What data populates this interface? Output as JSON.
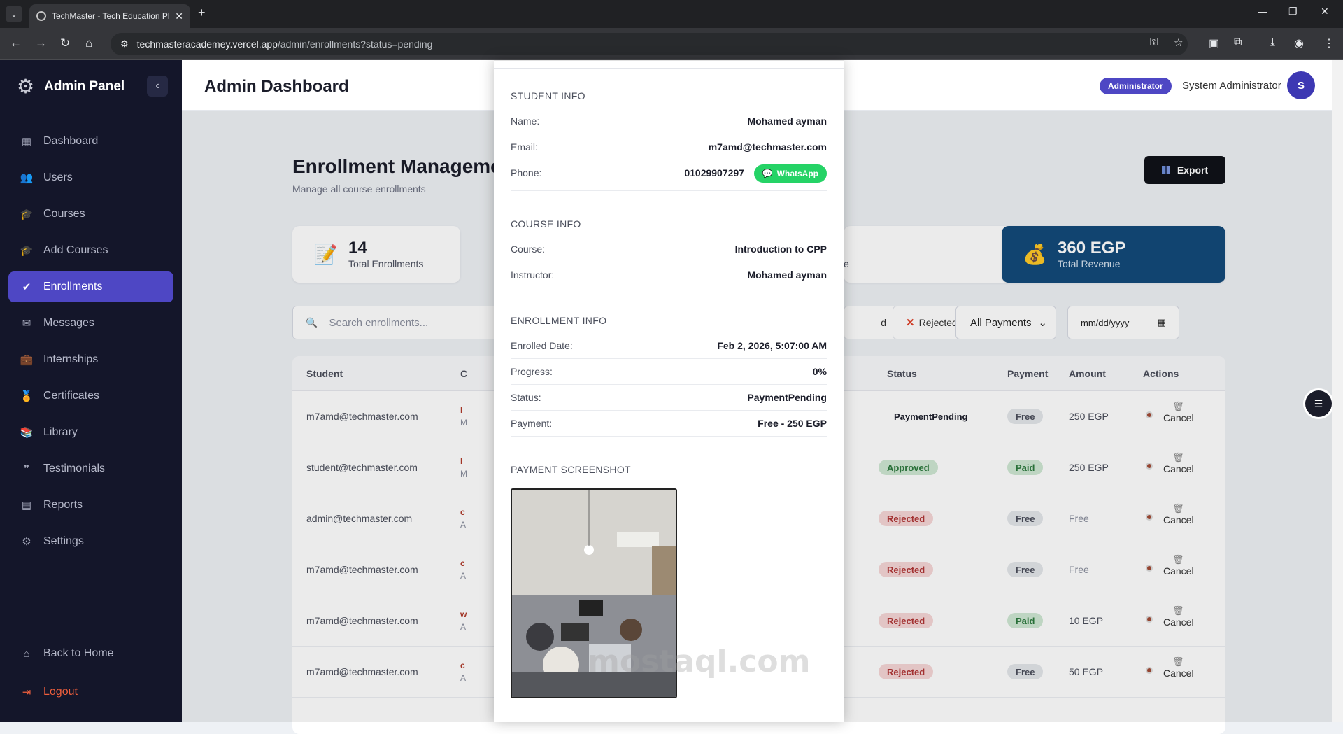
{
  "browser": {
    "tab_title": "TechMaster - Tech Education Pl",
    "url_host": "techmasteracademey.vercel.app",
    "url_path": "/admin/enrollments?status=pending"
  },
  "sidebar": {
    "title": "Admin Panel",
    "items": [
      {
        "label": "Dashboard",
        "icon": "dashboard-icon"
      },
      {
        "label": "Users",
        "icon": "users-icon"
      },
      {
        "label": "Courses",
        "icon": "courses-icon"
      },
      {
        "label": "Add Courses",
        "icon": "add-courses-icon"
      },
      {
        "label": "Enrollments",
        "icon": "enrollments-icon"
      },
      {
        "label": "Messages",
        "icon": "messages-icon"
      },
      {
        "label": "Internships",
        "icon": "internships-icon"
      },
      {
        "label": "Certificates",
        "icon": "certificates-icon"
      },
      {
        "label": "Library",
        "icon": "library-icon"
      },
      {
        "label": "Testimonials",
        "icon": "testimonials-icon"
      },
      {
        "label": "Reports",
        "icon": "reports-icon"
      },
      {
        "label": "Settings",
        "icon": "settings-icon"
      }
    ],
    "back_home": "Back to Home",
    "logout": "Logout"
  },
  "header": {
    "title": "Admin Dashboard",
    "role_badge": "Administrator",
    "user_name": "System Administrator",
    "avatar_letter": "S"
  },
  "page": {
    "title": "Enrollment Manageme",
    "subtitle": "Manage all course enrollments",
    "export_label": "Export"
  },
  "stats": {
    "total": {
      "value": "14",
      "label": "Total Enrollments"
    },
    "revenue": {
      "value": "360 EGP",
      "label": "Total Revenue"
    },
    "partial_label": "e"
  },
  "filters": {
    "search_placeholder": "Search enrollments...",
    "approved_stub": "d",
    "rejected_label": "Rejected",
    "payments_select": "All Payments",
    "date_placeholder": "mm/dd/yyyy"
  },
  "table": {
    "headers": {
      "student": "Student",
      "course_stub": "C",
      "status": "Status",
      "payment": "Payment",
      "amount": "Amount",
      "actions": "Actions"
    },
    "rows": [
      {
        "email": "m7amd@techmaster.com",
        "c1": "I",
        "c2": "M",
        "status": "PaymentPending",
        "payment": "Free",
        "amount": "250 EGP"
      },
      {
        "email": "student@techmaster.com",
        "c1": "I",
        "c2": "M",
        "status": "Approved",
        "payment": "Paid",
        "amount": "250 EGP"
      },
      {
        "email": "admin@techmaster.com",
        "c1": "c",
        "c2": "A",
        "status": "Rejected",
        "payment": "Free",
        "amount": "Free"
      },
      {
        "email": "m7amd@techmaster.com",
        "c1": "c",
        "c2": "A",
        "status": "Rejected",
        "payment": "Free",
        "amount": "Free"
      },
      {
        "email": "m7amd@techmaster.com",
        "c1": "w",
        "c2": "A",
        "status": "Rejected",
        "payment": "Paid",
        "amount": "10 EGP"
      },
      {
        "email": "m7amd@techmaster.com",
        "c1": "c",
        "c2": "A",
        "status": "Rejected",
        "payment": "Free",
        "amount": "50 EGP"
      }
    ],
    "cancel_label": "Cancel"
  },
  "modal": {
    "student_section": "STUDENT INFO",
    "name_k": "Name:",
    "name_v": "Mohamed ayman",
    "email_k": "Email:",
    "email_v": "m7amd@techmaster.com",
    "phone_k": "Phone:",
    "phone_v": "01029907297",
    "whatsapp": "WhatsApp",
    "course_section": "COURSE INFO",
    "course_k": "Course:",
    "course_v": "Introduction to CPP",
    "instructor_k": "Instructor:",
    "instructor_v": "Mohamed ayman",
    "enroll_section": "ENROLLMENT INFO",
    "date_k": "Enrolled Date:",
    "date_v": "Feb 2, 2026, 5:07:00 AM",
    "progress_k": "Progress:",
    "progress_v": "0%",
    "status_k": "Status:",
    "status_v": "PaymentPending",
    "payment_k": "Payment:",
    "payment_v": "Free - 250 EGP",
    "shot_section": "PAYMENT SCREENSHOT"
  },
  "watermark": "mostaql.com",
  "colors": {
    "accent": "#4e47c4",
    "sidebar": "#14162a",
    "revenue": "#134a7a",
    "whatsapp": "#25d366"
  }
}
